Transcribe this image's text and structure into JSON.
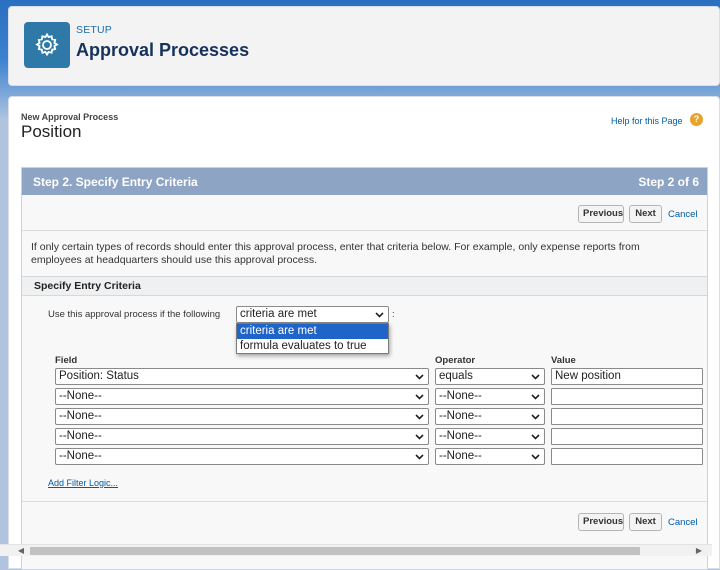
{
  "header": {
    "setup_label": "SETUP",
    "title": "Approval Processes",
    "icon": "gear-icon"
  },
  "page": {
    "subtitle": "New Approval Process",
    "name": "Position",
    "help_link": "Help for this Page",
    "help_icon": "?"
  },
  "step": {
    "title": "Step 2. Specify Entry Criteria",
    "count": "Step 2 of 6"
  },
  "buttons": {
    "previous": "Previous",
    "next": "Next",
    "cancel": "Cancel"
  },
  "info_text": "If only certain types of records should enter this approval process, enter that criteria below. For example, only expense reports from employees at headquarters should use this approval process.",
  "section": {
    "title": "Specify Entry Criteria",
    "use_label": "Use this approval process if the following",
    "colon": ":",
    "criteria_selected": "criteria are met",
    "criteria_options": [
      "criteria are met",
      "formula evaluates to true"
    ]
  },
  "columns": {
    "field": "Field",
    "operator": "Operator",
    "value": "Value"
  },
  "rows": [
    {
      "field": "Position: Status",
      "operator": "equals",
      "value": "New position"
    },
    {
      "field": "--None--",
      "operator": "--None--",
      "value": ""
    },
    {
      "field": "--None--",
      "operator": "--None--",
      "value": ""
    },
    {
      "field": "--None--",
      "operator": "--None--",
      "value": ""
    },
    {
      "field": "--None--",
      "operator": "--None--",
      "value": ""
    }
  ],
  "add_filter_logic": "Add Filter Logic...",
  "colors": {
    "step_bar": "#8ea4c5",
    "link": "#015ba7",
    "title": "#16325c",
    "icon_bg": "#2f79a8",
    "selected_option": "#1f64c8"
  }
}
